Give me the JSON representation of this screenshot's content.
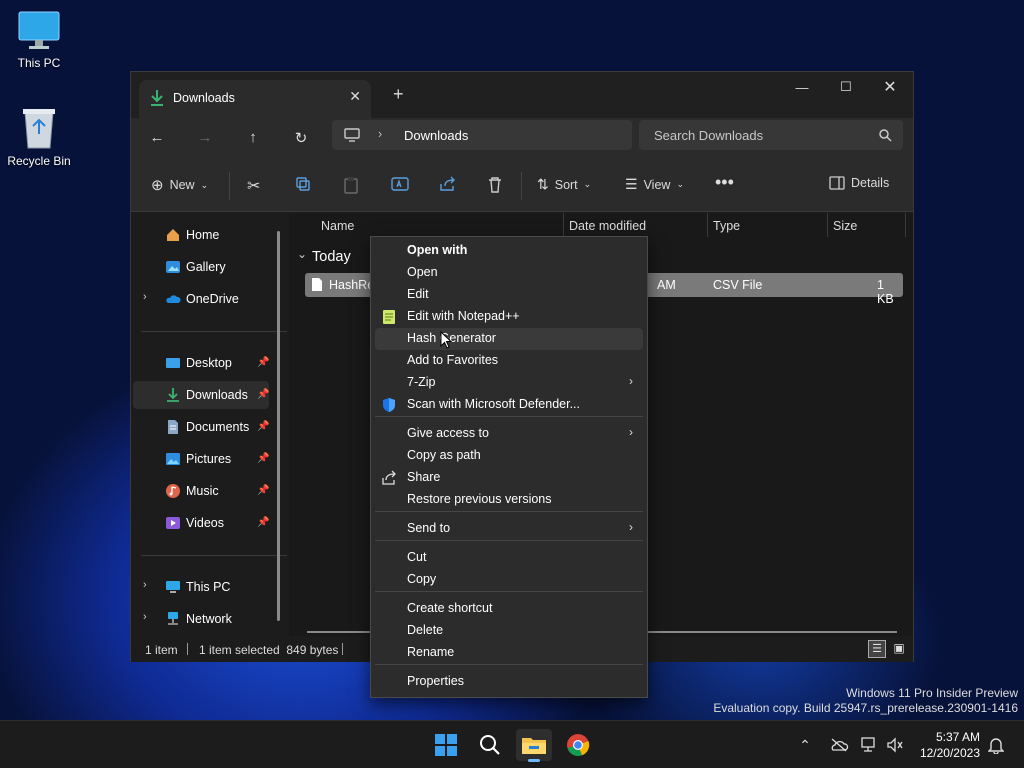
{
  "desktop": {
    "icons": [
      {
        "label": "This PC"
      },
      {
        "label": "Recycle Bin"
      }
    ]
  },
  "window": {
    "tab_title": "Downloads",
    "address": {
      "crumb": "Downloads"
    },
    "search": {
      "placeholder": "Search Downloads"
    },
    "commands": {
      "new": "New",
      "sort": "Sort",
      "view": "View",
      "details": "Details"
    },
    "nav": {
      "items": [
        {
          "label": "Home"
        },
        {
          "label": "Gallery"
        },
        {
          "label": "OneDrive"
        },
        {
          "label": "Desktop"
        },
        {
          "label": "Downloads"
        },
        {
          "label": "Documents"
        },
        {
          "label": "Pictures"
        },
        {
          "label": "Music"
        },
        {
          "label": "Videos"
        },
        {
          "label": "This PC"
        },
        {
          "label": "Network"
        }
      ]
    },
    "columns": {
      "name": "Name",
      "date": "Date modified",
      "type": "Type",
      "size": "Size"
    },
    "group": "Today",
    "file": {
      "name": "HashRep",
      "date_tail": "AM",
      "type": "CSV File",
      "size": "1 KB"
    },
    "status": {
      "count": "1 item",
      "selection": "1 item selected  849 bytes"
    }
  },
  "context_menu": {
    "items": [
      {
        "label": "Open with",
        "icon": "none",
        "bold": true
      },
      {
        "label": "Open",
        "icon": "none"
      },
      {
        "label": "Edit",
        "icon": "none"
      },
      {
        "label": "Edit with Notepad++",
        "icon": "notepadpp-icon"
      },
      {
        "label": "Hash Generator",
        "icon": "none"
      },
      {
        "label": "Add to Favorites",
        "icon": "none"
      },
      {
        "label": "7-Zip",
        "icon": "none",
        "submenu": true
      },
      {
        "label": "Scan with Microsoft Defender...",
        "icon": "defender-shield-icon"
      },
      {
        "label": "Give access to",
        "icon": "none",
        "submenu": true
      },
      {
        "label": "Copy as path",
        "icon": "none"
      },
      {
        "label": "Share",
        "icon": "share-icon"
      },
      {
        "label": "Restore previous versions",
        "icon": "none"
      },
      {
        "label": "Send to",
        "icon": "none",
        "submenu": true
      },
      {
        "label": "Cut",
        "icon": "none"
      },
      {
        "label": "Copy",
        "icon": "none"
      },
      {
        "label": "Create shortcut",
        "icon": "none"
      },
      {
        "label": "Delete",
        "icon": "none"
      },
      {
        "label": "Rename",
        "icon": "none"
      },
      {
        "label": "Properties",
        "icon": "none"
      }
    ]
  },
  "watermark": {
    "line1": "Windows 11 Pro Insider Preview",
    "line2": "Evaluation copy. Build 25947.rs_prerelease.230901-1416"
  },
  "taskbar": {
    "time": "5:37 AM",
    "date": "12/20/2023"
  },
  "colors": {
    "accent": "#0078d4",
    "downloads_green": "#3cb371"
  }
}
